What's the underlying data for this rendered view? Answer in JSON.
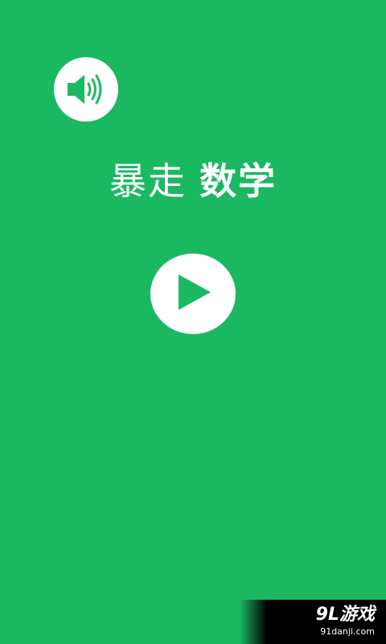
{
  "title": {
    "part1": "暴走",
    "part2": "数学"
  },
  "buttons": {
    "sound_icon": "speaker-volume-icon",
    "play_icon": "play-icon"
  },
  "watermark": {
    "main": "9L游戏",
    "url": "91danji.com"
  },
  "colors": {
    "background": "#1bb862",
    "icon_fill": "#1bb862",
    "button_bg": "#ffffff",
    "text": "#ffffff"
  }
}
